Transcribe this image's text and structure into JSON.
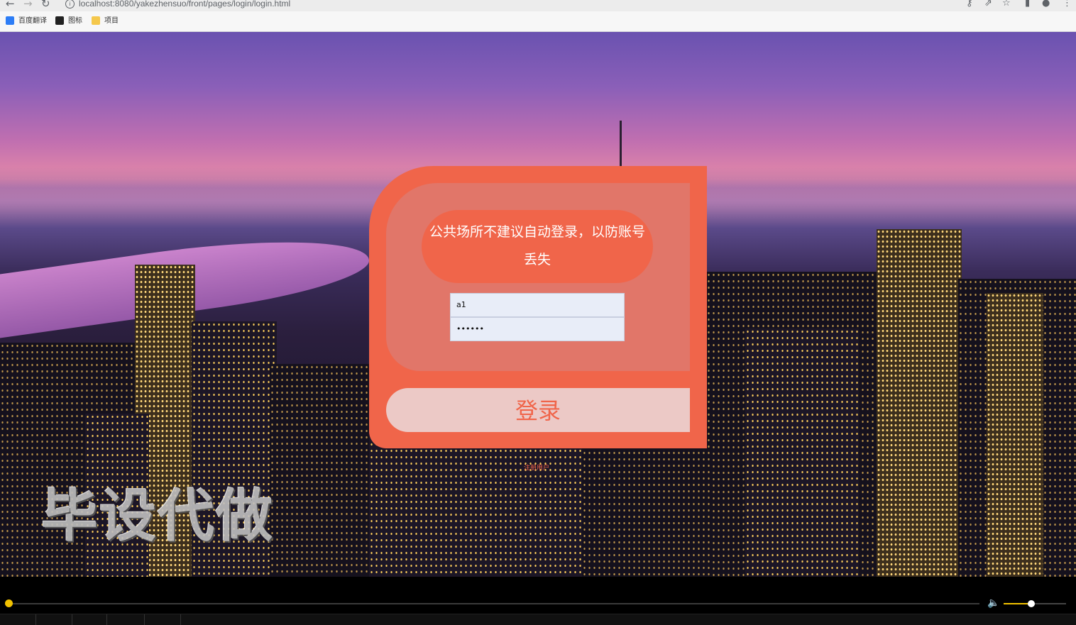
{
  "browser": {
    "url": "localhost:8080/yakezhensuo/front/pages/login/login.html",
    "bookmarks": [
      {
        "label": "百度翻译",
        "icon": "baidu-translate-icon",
        "color": "#2d7df6"
      },
      {
        "label": "图标",
        "icon": "image-icon",
        "color": "#222222"
      },
      {
        "label": "项目",
        "icon": "folder-icon",
        "color": "#f5c84c"
      }
    ]
  },
  "login": {
    "notice": "公共场所不建议自动登录，以防账号丢失",
    "username_value": "a1",
    "password_value": "••••••",
    "login_label": "登录",
    "register_label": "注册用户"
  },
  "overlay": {
    "watermark": "毕设代做"
  },
  "player": {
    "progress": 0.0,
    "volume": 0.4
  },
  "colors": {
    "accent": "#f0654a",
    "player_accent": "#f2c200"
  }
}
